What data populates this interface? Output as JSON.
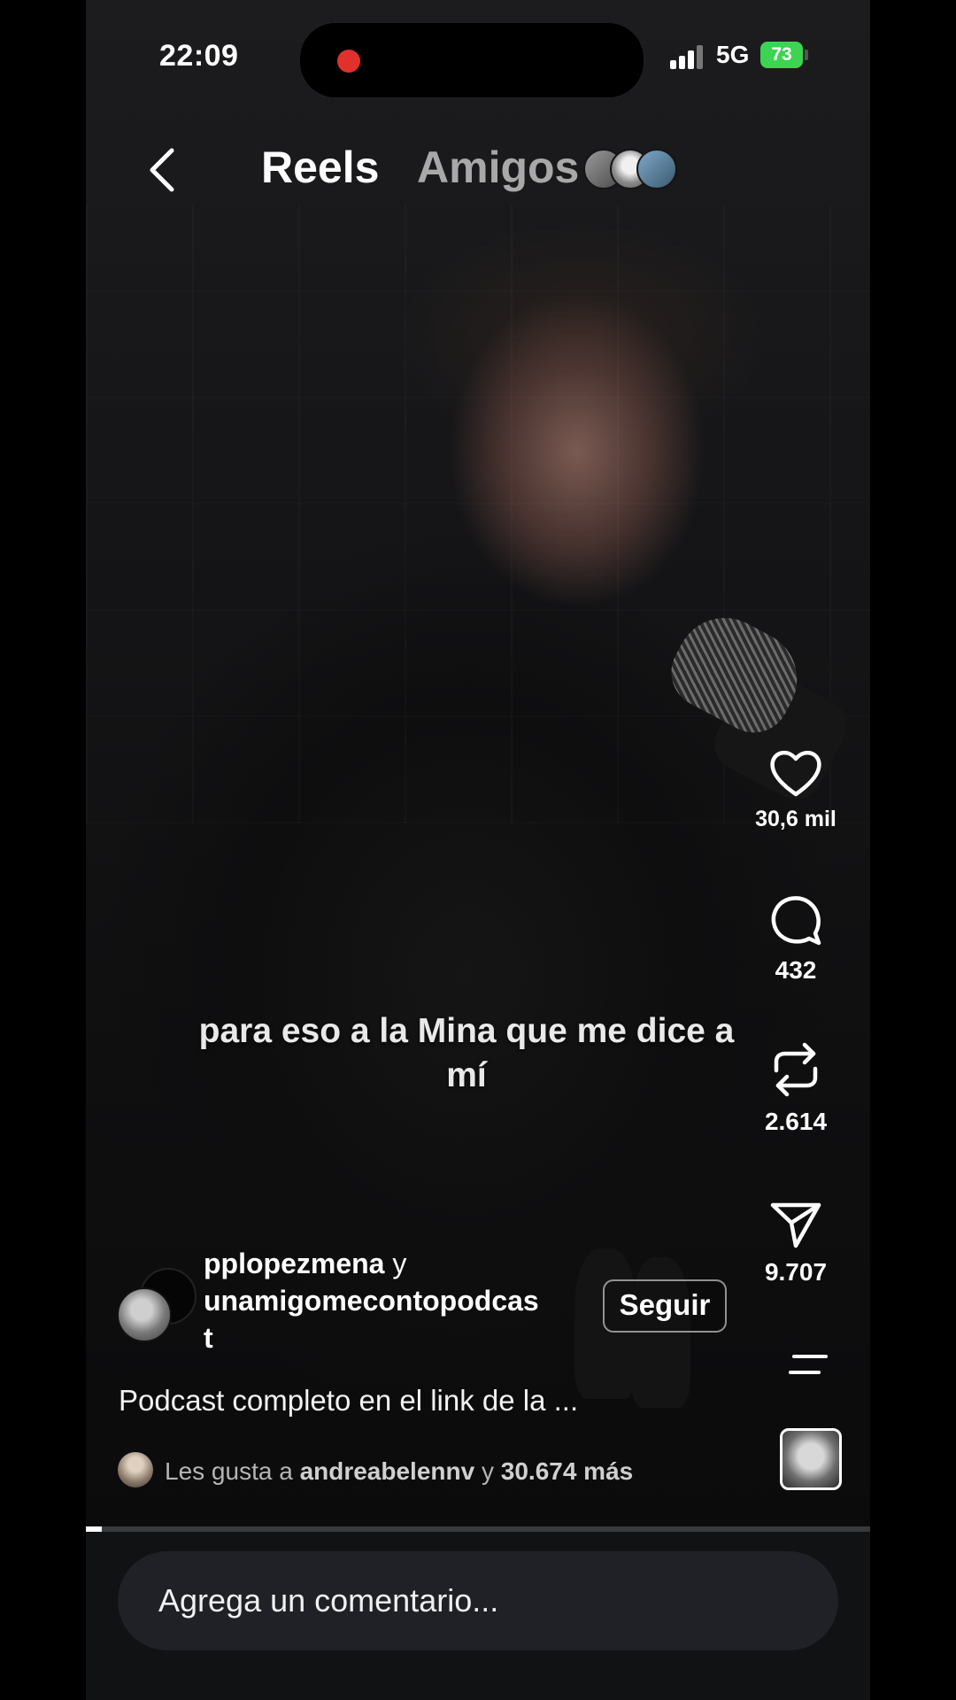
{
  "status_bar": {
    "time": "22:09",
    "network": "5G",
    "battery": "73"
  },
  "header": {
    "tabs": [
      {
        "label": "Reels",
        "active": true
      },
      {
        "label": "Amigos",
        "active": false
      }
    ]
  },
  "video": {
    "subtitle": "para eso a la Mina que me dice a mí"
  },
  "actions": {
    "likes": "30,6 mil",
    "comments": "432",
    "reposts": "2.614",
    "shares": "9.707"
  },
  "post": {
    "author_primary": "pplopezmena",
    "author_joiner": "y",
    "author_secondary_line1": "unamigomecontopodcas",
    "author_secondary_line2": "t",
    "follow_label": "Seguir",
    "caption": "Podcast completo en el link de la ...",
    "likes_prefix": "Les gusta a",
    "likes_user": "andreabelennv",
    "likes_joiner": "y",
    "likes_more": "30.674 más"
  },
  "comment_bar": {
    "placeholder": "Agrega un comentario..."
  },
  "colors": {
    "battery": "#3cd452",
    "record_dot": "#e0312c",
    "inactive_tab": "#a8a8a8"
  }
}
